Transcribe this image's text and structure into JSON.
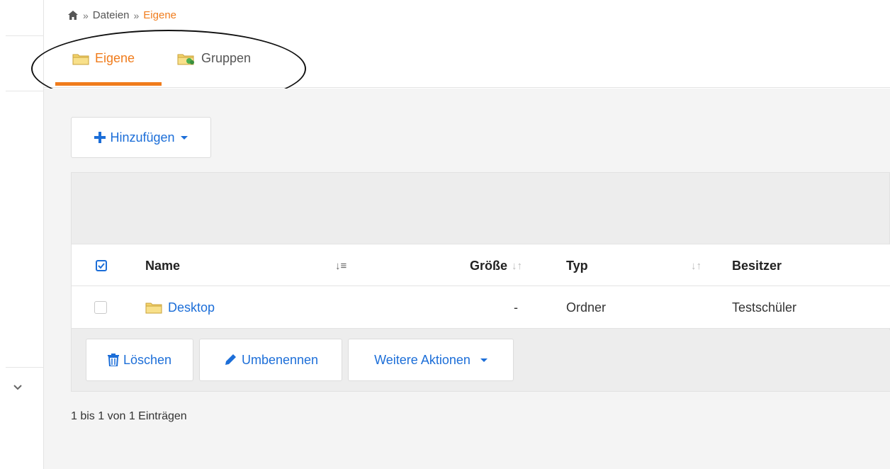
{
  "breadcrumb": {
    "home_icon": "home-icon",
    "separator": "»",
    "items": [
      "Dateien",
      "Eigene"
    ]
  },
  "tabs": [
    {
      "label": "Eigene",
      "icon": "folder-icon",
      "active": true
    },
    {
      "label": "Gruppen",
      "icon": "group-folder-icon",
      "active": false
    }
  ],
  "toolbar": {
    "add_label": "Hinzufügen"
  },
  "table": {
    "columns": [
      "Name",
      "Größe",
      "Typ",
      "Besitzer"
    ],
    "rows": [
      {
        "name": "Desktop",
        "size": "-",
        "type": "Ordner",
        "owner": "Testschüler"
      }
    ]
  },
  "actions": {
    "delete_label": "Löschen",
    "rename_label": "Umbenennen",
    "more_label": "Weitere Aktionen"
  },
  "footer": {
    "count_text": "1 bis 1 von 1 Einträgen"
  },
  "colors": {
    "accent": "#f07c1c",
    "link": "#1c6ed8",
    "background": "#f4f4f4"
  }
}
